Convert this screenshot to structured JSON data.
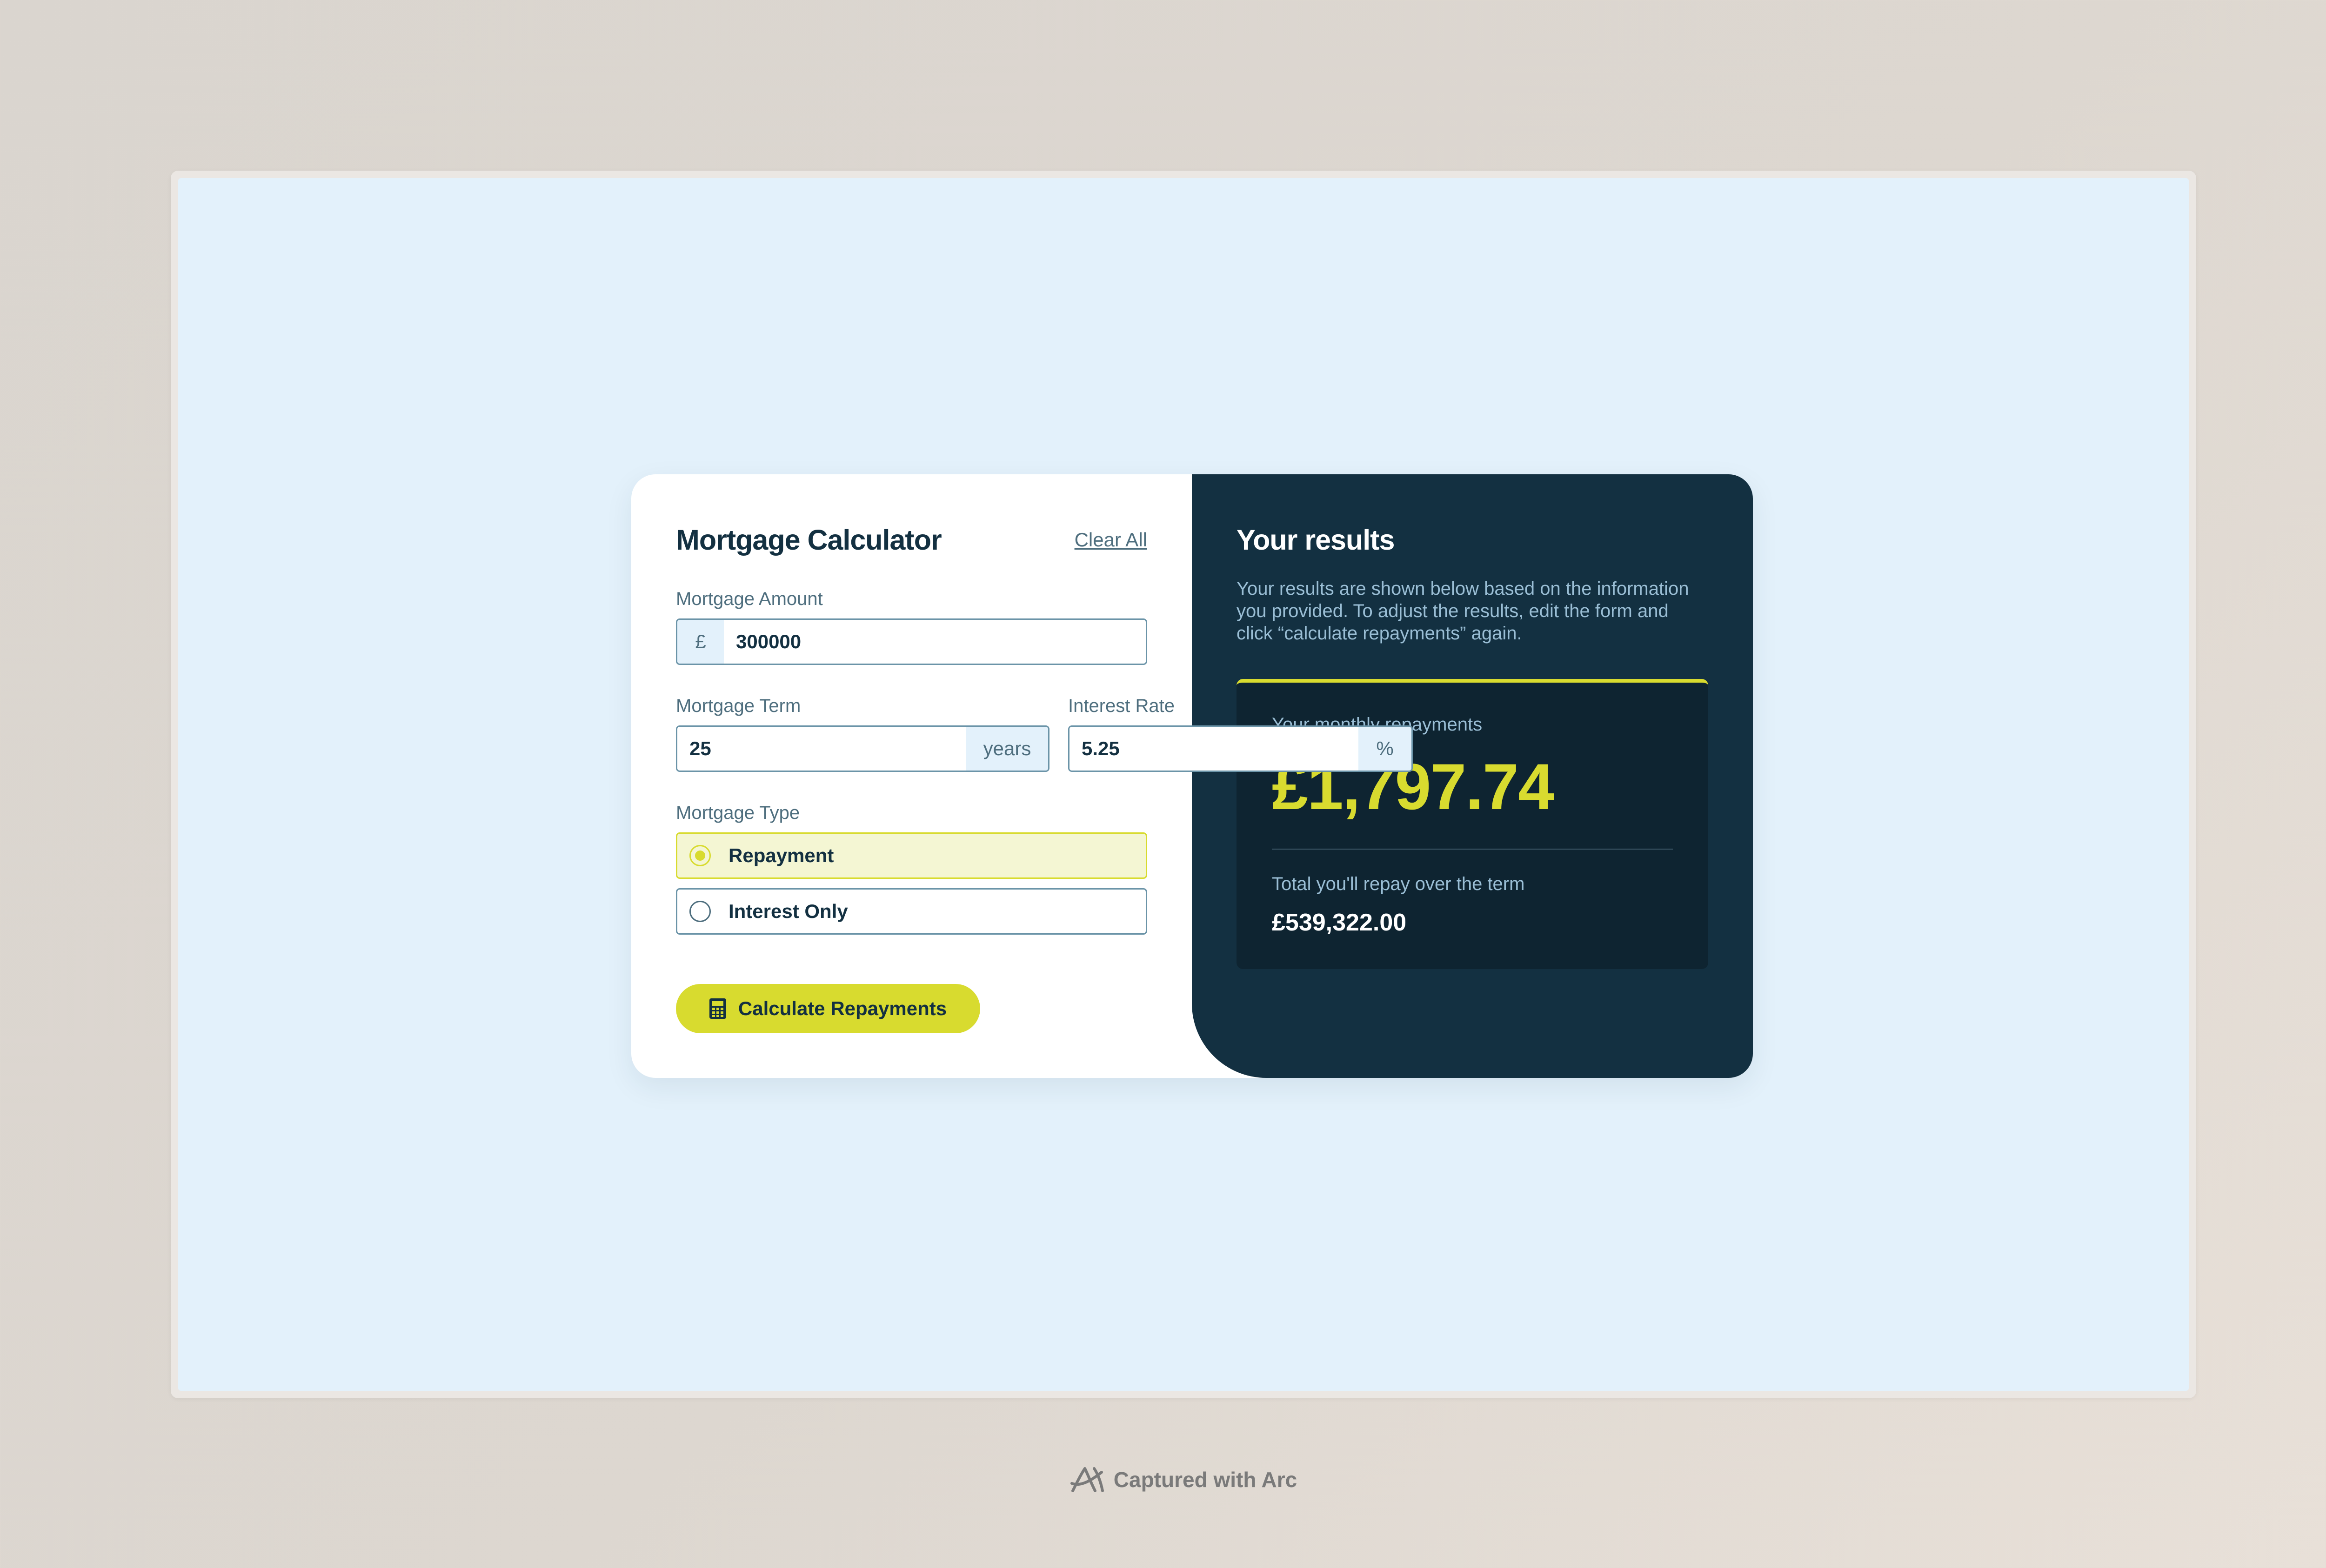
{
  "form": {
    "title": "Mortgage Calculator",
    "clear_label": "Clear All",
    "amount": {
      "label": "Mortgage Amount",
      "prefix": "£",
      "value": "300000"
    },
    "term": {
      "label": "Mortgage Term",
      "value": "25",
      "suffix": "years"
    },
    "rate": {
      "label": "Interest Rate",
      "value": "5.25",
      "suffix": "%"
    },
    "type": {
      "label": "Mortgage Type",
      "options": [
        {
          "label": "Repayment",
          "selected": true
        },
        {
          "label": "Interest Only",
          "selected": false
        }
      ]
    },
    "submit_label": "Calculate Repayments"
  },
  "results": {
    "title": "Your results",
    "description": "Your results are shown below based on the information you provided. To adjust the results, edit the form and click “calculate repayments” again.",
    "monthly_label": "Your monthly repayments",
    "monthly_value": "£1,797.74",
    "total_label": "Total you'll repay over the term",
    "total_value": "£539,322.00"
  },
  "footer": {
    "text": "Captured with Arc",
    "icon": "arc-logo-icon"
  },
  "colors": {
    "primary_lime": "#d8db2f",
    "dark_slate": "#133041",
    "darker_slate": "#0e2431",
    "light_blue": "#e3f1fb",
    "muted_text": "#4e6e7e"
  }
}
